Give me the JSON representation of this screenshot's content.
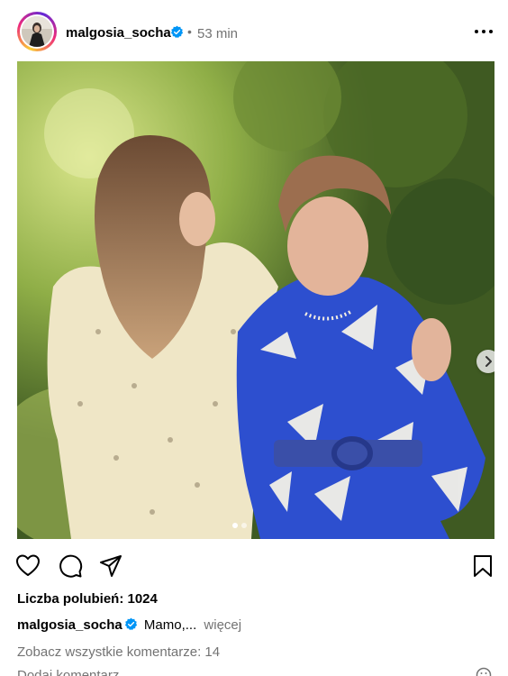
{
  "post": {
    "username": "malgosia_socha",
    "separator": "•",
    "time": "53 min",
    "icons": {
      "verified": "verified-badge-icon",
      "more": "more-options-icon",
      "like": "heart-icon",
      "comment": "comment-icon",
      "share": "share-icon",
      "save": "bookmark-icon",
      "next": "chevron-right-icon",
      "emoji": "emoji-icon"
    },
    "carousel": {
      "total": 2,
      "active": 1
    },
    "likes": "Liczba polubień: 1024",
    "caption": {
      "username": "malgosia_socha",
      "text": "Mamo,...",
      "more": "więcej"
    },
    "comments_link": "Zobacz wszystkie komentarze: 14",
    "add_comment_placeholder": "Dodaj komentarz..."
  },
  "colors": {
    "verified": "#0095f6",
    "secondary_text": "#737373",
    "avatar_ring": "#ee2a7b"
  }
}
